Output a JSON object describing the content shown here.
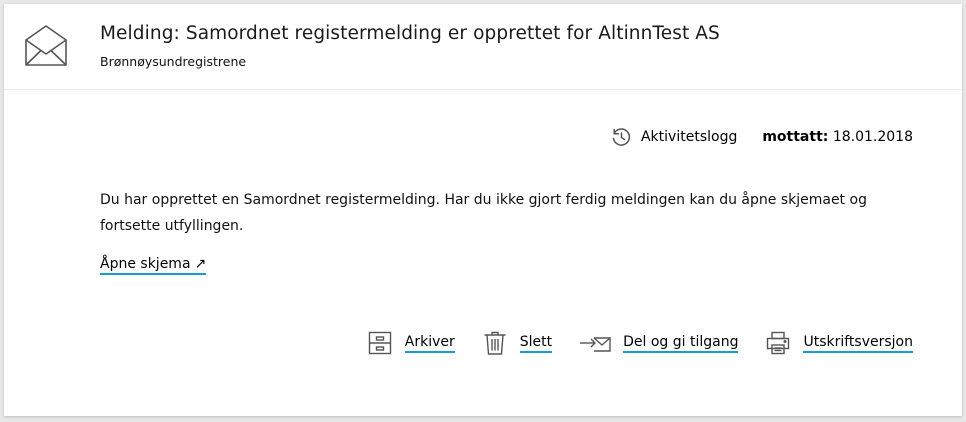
{
  "message": {
    "title": "Melding: Samordnet registermelding er opprettet for AltinnTest AS",
    "sender": "Brønnøysundregistrene",
    "icon": "envelope-icon"
  },
  "meta": {
    "activity_log_label": "Aktivitetslogg",
    "received_label": "mottatt:",
    "received_date": "18.01.2018"
  },
  "body": {
    "text": "Du har opprettet en Samordnet registermelding. Har du ikke gjort ferdig meldingen kan du åpne skjemaet og fortsette utfyllingen.",
    "open_form_label": "Åpne skjema",
    "open_form_arrow": "↗"
  },
  "actions": [
    {
      "label": "Arkiver",
      "icon": "archive-icon"
    },
    {
      "label": "Slett",
      "icon": "trash-icon"
    },
    {
      "label": "Del og gi tilgang",
      "icon": "share-icon"
    },
    {
      "label": "Utskriftsversjon",
      "icon": "print-icon"
    }
  ],
  "colors": {
    "link_underline": "#1a9bd7",
    "icon_stroke": "#555555"
  }
}
